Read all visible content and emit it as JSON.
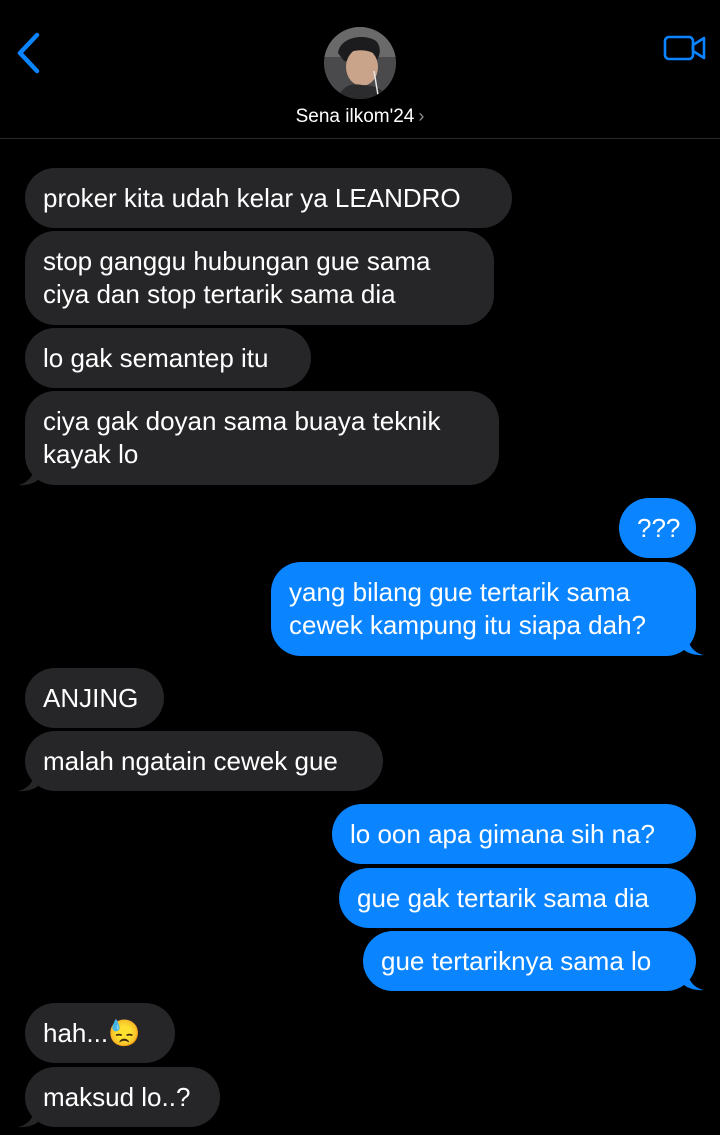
{
  "header": {
    "contact_name": "Sena ilkom'24",
    "chevron": "›",
    "icons": {
      "back": "chevron-left-icon",
      "video": "video-camera-icon",
      "avatar": "avatar"
    },
    "accent_color": "#0a84ff"
  },
  "messages": [
    {
      "direction": "incoming",
      "text": "proker kita udah kelar ya LEANDRO"
    },
    {
      "direction": "incoming",
      "text": "stop ganggu hubungan gue sama ciya dan stop tertarik sama dia"
    },
    {
      "direction": "incoming",
      "text": "lo gak semantep itu"
    },
    {
      "direction": "incoming",
      "text": "ciya gak doyan sama buaya teknik kayak lo"
    },
    {
      "direction": "outgoing",
      "text": "???"
    },
    {
      "direction": "outgoing",
      "text": "yang bilang gue tertarik sama cewek kampung itu siapa dah?"
    },
    {
      "direction": "incoming",
      "text": "ANJING"
    },
    {
      "direction": "incoming",
      "text": "malah ngatain cewek gue"
    },
    {
      "direction": "outgoing",
      "text": "lo oon apa gimana sih na?"
    },
    {
      "direction": "outgoing",
      "text": "gue gak tertarik sama dia"
    },
    {
      "direction": "outgoing",
      "text": "gue tertariknya sama lo"
    },
    {
      "direction": "incoming",
      "text": "hah...😓"
    },
    {
      "direction": "incoming",
      "text": "maksud lo..?"
    }
  ],
  "colors": {
    "background": "#000000",
    "incoming_bubble": "#262628",
    "outgoing_bubble": "#0a84ff"
  }
}
